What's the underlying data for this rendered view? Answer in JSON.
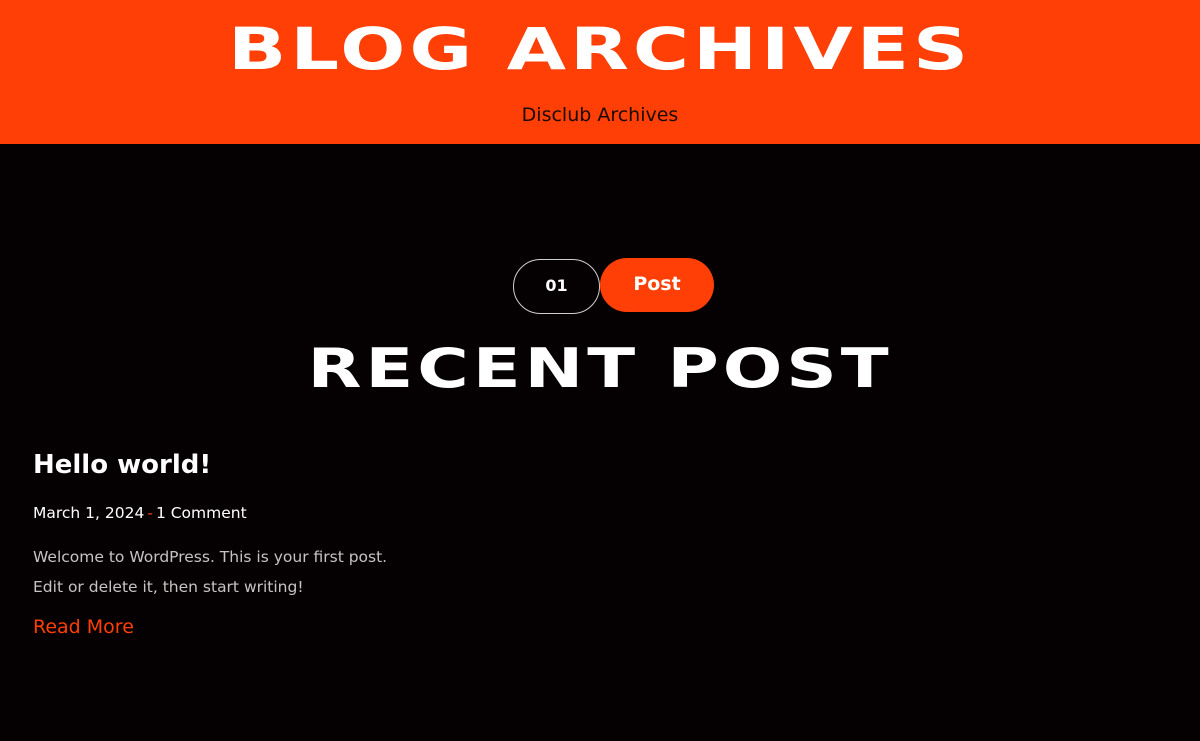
{
  "hero": {
    "title": "BLOG ARCHIVES",
    "subtitle": "Disclub Archives",
    "background_color": "#ff3f05"
  },
  "section": {
    "number_badge": "01",
    "label_badge": "Post",
    "title": "RECENT POST"
  },
  "posts": [
    {
      "title": "Hello world!",
      "date": "March 1, 2024",
      "separator": "-",
      "comments": "1 Comment",
      "excerpt": "Welcome to WordPress. This is your first post. Edit or delete it, then start writing!",
      "read_more_label": "Read More"
    }
  ],
  "colors": {
    "accent": "#ff3f05",
    "background": "#050103",
    "text": "#ffffff",
    "muted_text": "#c8c3c3"
  }
}
